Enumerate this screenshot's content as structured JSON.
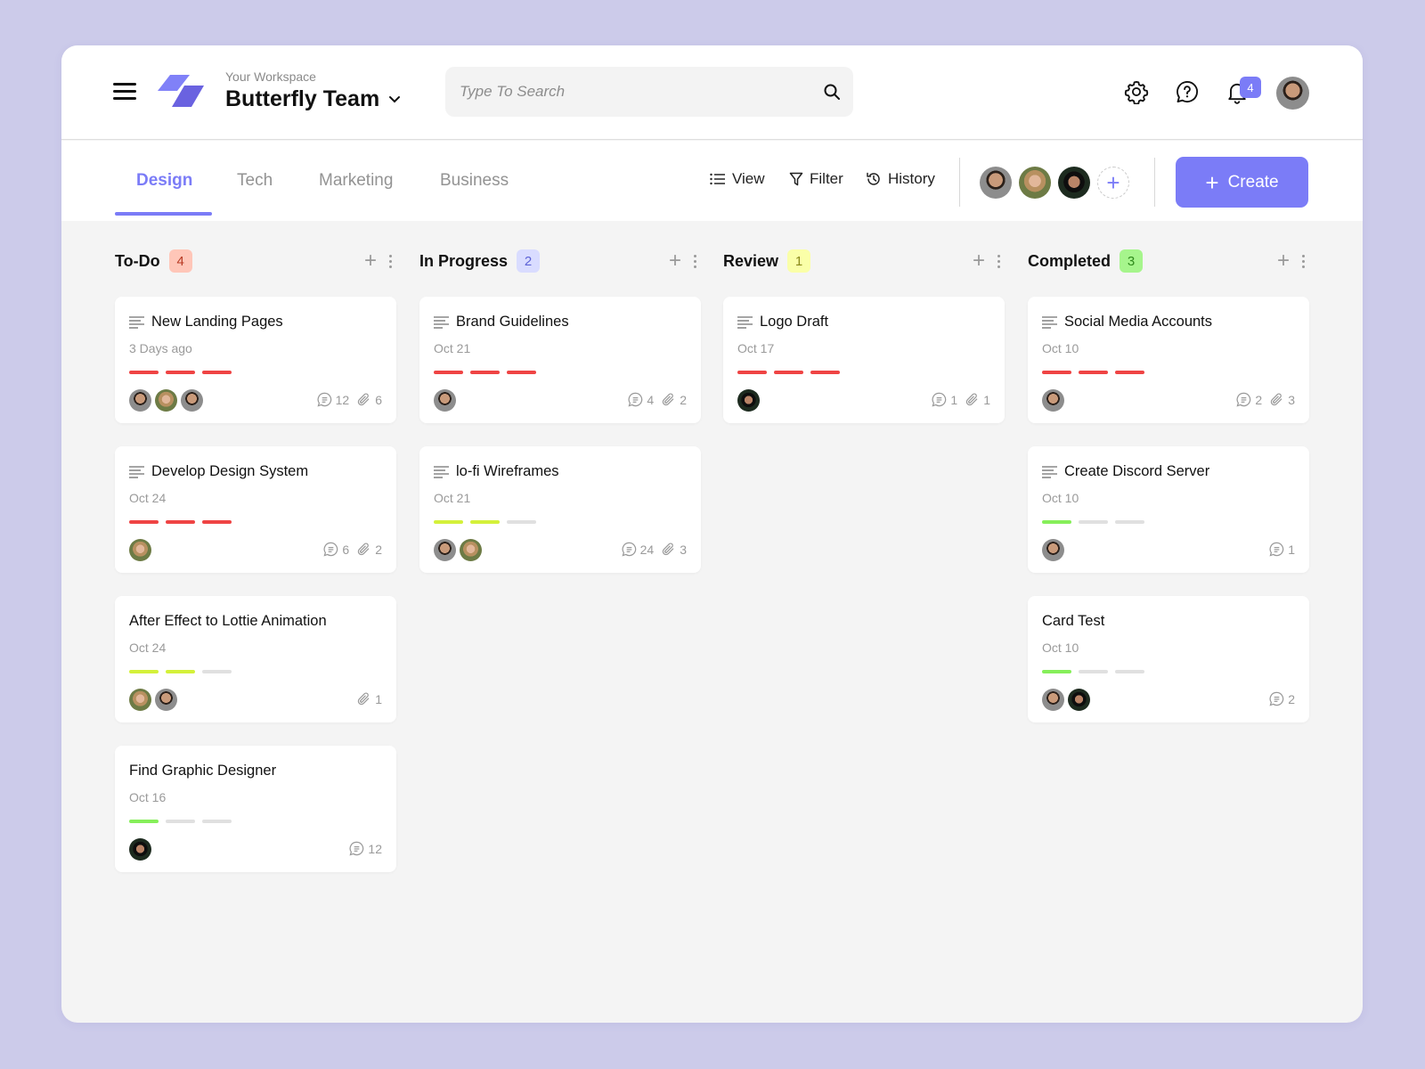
{
  "header": {
    "workspace_label": "Your Workspace",
    "workspace_name": "Butterfly Team",
    "search_placeholder": "Type To Search",
    "search_value": "",
    "notification_count": "4",
    "icons": [
      "menu-icon",
      "logo-icon",
      "chevron-down-icon",
      "search-icon",
      "gear-icon",
      "help-chat-icon",
      "bell-icon"
    ]
  },
  "tabs": [
    {
      "label": "Design",
      "active": true
    },
    {
      "label": "Tech",
      "active": false
    },
    {
      "label": "Marketing",
      "active": false
    },
    {
      "label": "Business",
      "active": false
    }
  ],
  "toolbar": {
    "view_label": "View",
    "filter_label": "Filter",
    "history_label": "History",
    "create_label": "Create",
    "team_members": [
      "member-1",
      "member-2",
      "member-3"
    ]
  },
  "colors": {
    "accent": "#7b7cf7",
    "priority_red": "#ef4444",
    "priority_lime": "#d4f13a",
    "priority_green": "#86ef5a",
    "priority_empty": "#e0e0e0",
    "badge_todo_bg": "#ffc6b8",
    "badge_todo_fg": "#b83a23",
    "badge_progress_bg": "#d9dcff",
    "badge_progress_fg": "#5c62d6",
    "badge_review_bg": "#faffa8",
    "badge_review_fg": "#8a8a1a",
    "badge_done_bg": "#a6f58c",
    "badge_done_fg": "#2f8a1c"
  },
  "columns": [
    {
      "title": "To-Do",
      "count": "4",
      "cards": [
        {
          "title": "New Landing Pages",
          "has_description": true,
          "date": "3 Days ago",
          "priority": [
            "red",
            "red",
            "red"
          ],
          "avatars": [
            "m1",
            "f1",
            "m1"
          ],
          "comments": "12",
          "attachments": "6"
        },
        {
          "title": "Develop Design System",
          "has_description": true,
          "date": "Oct 24",
          "priority": [
            "red",
            "red",
            "red"
          ],
          "avatars": [
            "f1"
          ],
          "comments": "6",
          "attachments": "2"
        },
        {
          "title": "After Effect to Lottie Animation",
          "has_description": false,
          "date": "Oct 24",
          "priority": [
            "lime",
            "lime",
            "empty"
          ],
          "avatars": [
            "f1",
            "m1"
          ],
          "comments": null,
          "attachments": "1"
        },
        {
          "title": "Find Graphic Designer",
          "has_description": false,
          "date": "Oct 16",
          "priority": [
            "green",
            "empty",
            "empty"
          ],
          "avatars": [
            "m2"
          ],
          "comments": "12",
          "attachments": null
        }
      ]
    },
    {
      "title": "In Progress",
      "count": "2",
      "cards": [
        {
          "title": "Brand Guidelines",
          "has_description": true,
          "date": "Oct 21",
          "priority": [
            "red",
            "red",
            "red"
          ],
          "avatars": [
            "m1"
          ],
          "comments": "4",
          "attachments": "2"
        },
        {
          "title": "lo-fi Wireframes",
          "has_description": true,
          "date": "Oct 21",
          "priority": [
            "lime",
            "lime",
            "empty"
          ],
          "avatars": [
            "m1",
            "f1"
          ],
          "comments": "24",
          "attachments": "3"
        }
      ]
    },
    {
      "title": "Review",
      "count": "1",
      "cards": [
        {
          "title": "Logo Draft",
          "has_description": true,
          "date": "Oct 17",
          "priority": [
            "red",
            "red",
            "red"
          ],
          "avatars": [
            "m2"
          ],
          "comments": "1",
          "attachments": "1"
        }
      ]
    },
    {
      "title": "Completed",
      "count": "3",
      "cards": [
        {
          "title": "Social Media Accounts",
          "has_description": true,
          "date": "Oct 10",
          "priority": [
            "red",
            "red",
            "red"
          ],
          "avatars": [
            "m1"
          ],
          "comments": "2",
          "attachments": "3"
        },
        {
          "title": "Create Discord Server",
          "has_description": true,
          "date": "Oct 10",
          "priority": [
            "green",
            "empty",
            "empty"
          ],
          "avatars": [
            "m1"
          ],
          "comments": "1",
          "attachments": null
        },
        {
          "title": "Card Test",
          "has_description": false,
          "date": "Oct 10",
          "priority": [
            "green",
            "empty",
            "empty"
          ],
          "avatars": [
            "m1",
            "m2"
          ],
          "comments": "2",
          "attachments": null
        }
      ]
    }
  ]
}
